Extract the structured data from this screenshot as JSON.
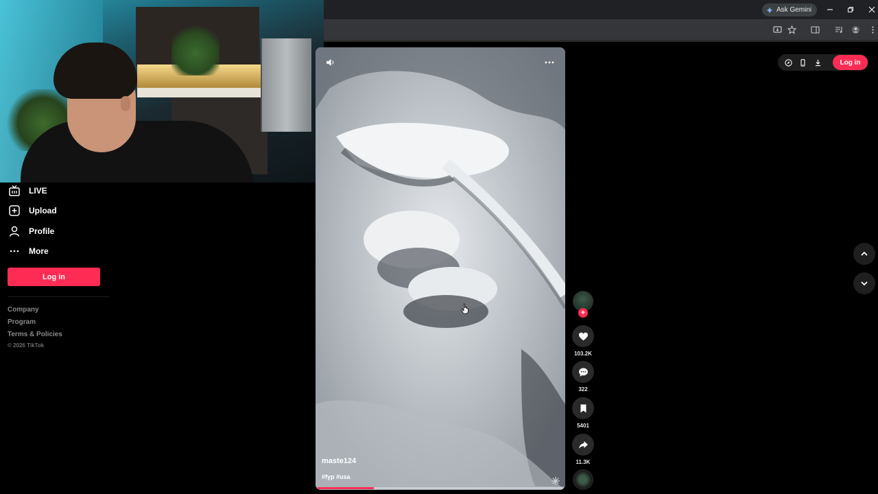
{
  "browser": {
    "gemini_label": "Ask Gemini",
    "icons": [
      "gemini-sparkle-icon",
      "minimize-icon",
      "restore-icon",
      "close-icon",
      "install-app-icon",
      "bookmark-star-icon",
      "side-panel-icon",
      "media-icon",
      "profile-icon",
      "menu-icon"
    ]
  },
  "sidebar": {
    "items": [
      {
        "label": "LIVE",
        "icon": "live-tv-icon"
      },
      {
        "label": "Upload",
        "icon": "upload-plus-icon"
      },
      {
        "label": "Profile",
        "icon": "person-icon"
      },
      {
        "label": "More",
        "icon": "more-dots-icon"
      }
    ],
    "login_label": "Log in",
    "footer": {
      "links": [
        "Company",
        "Program",
        "Terms & Policies"
      ],
      "copyright": "© 2026 TikTok"
    }
  },
  "video": {
    "username": "maste124",
    "hashtags": "#fyp #usa",
    "progress": 0.23
  },
  "actions": {
    "likes": "103.2K",
    "comments": "322",
    "saves": "5401",
    "shares": "11.3K"
  },
  "topbar": {
    "login_label": "Log in"
  },
  "colors": {
    "accent": "#fe2c55",
    "background": "#000000"
  }
}
